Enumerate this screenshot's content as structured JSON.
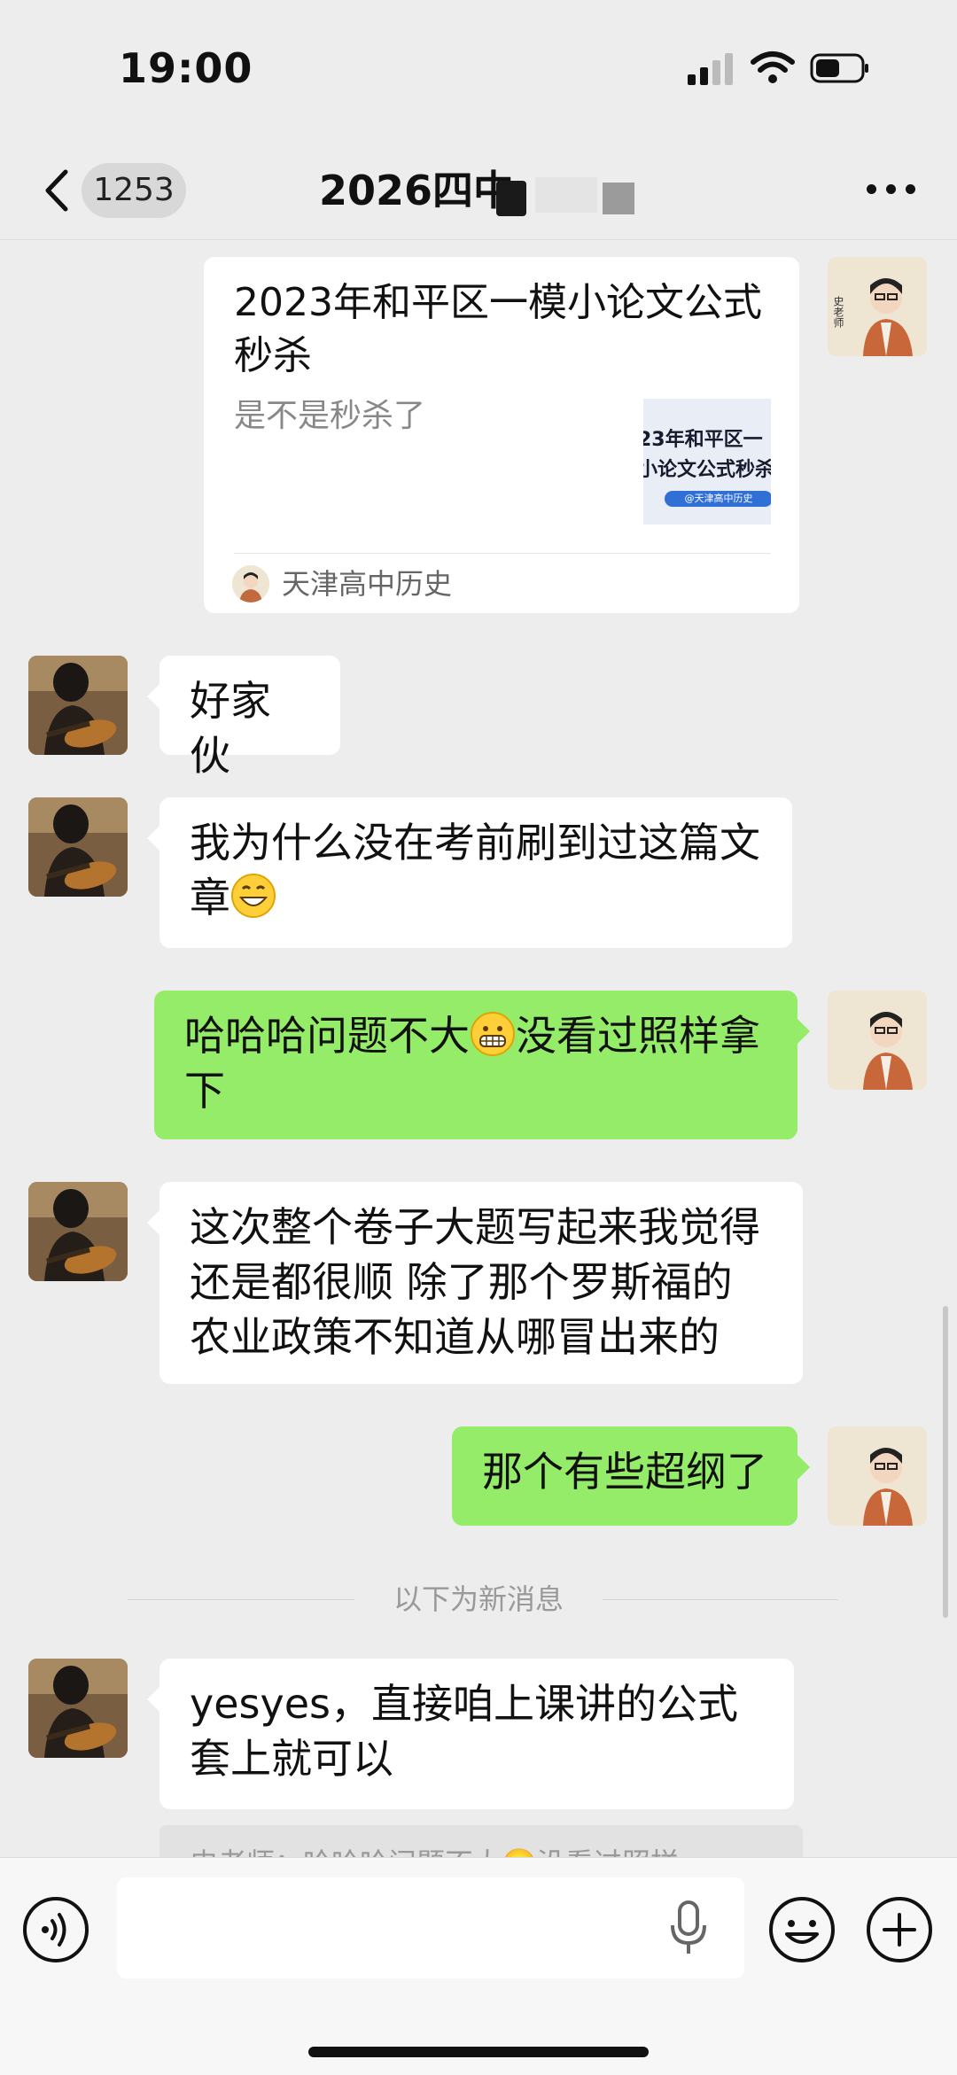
{
  "status_bar": {
    "time": "19:00"
  },
  "nav": {
    "unread_count": "1253",
    "title": "2026四中"
  },
  "article_card": {
    "title": "2023年和平区一模小论文公式秒杀",
    "description": "是不是秒杀了",
    "thumb_line1": "23年和平区一",
    "thumb_line2": "小论文公式秒杀",
    "thumb_tag": "@天津高中历史",
    "source": "天津高中历史",
    "avatar_text": "史老师"
  },
  "messages": [
    {
      "sender": "student",
      "text": "好家伙"
    },
    {
      "sender": "student",
      "text_before": "我为什么没在考前刷到过这篇文章",
      "emoji": "grinning-face"
    },
    {
      "sender": "me",
      "text_before": "哈哈哈问题不大",
      "emoji": "grimacing-face",
      "text_after": "没看过照样拿下"
    },
    {
      "sender": "student",
      "text": "这次整个卷子大题写起来我觉得还是都很顺 除了那个罗斯福的农业政策不知道从哪冒出来的"
    },
    {
      "sender": "me",
      "text": "那个有些超纲了"
    },
    {
      "sender": "student",
      "text": "yesyes，直接咱上课讲的公式套上就可以"
    }
  ],
  "new_messages_divider": "以下为新消息",
  "quote_preview": "史老师：哈哈哈问题不大😬没看过照样",
  "input_bar": {
    "text_value": ""
  },
  "colors": {
    "background": "#ededed",
    "my_bubble": "#95ec69",
    "their_bubble": "#ffffff"
  },
  "icons": [
    "back-arrow-icon",
    "more-icon",
    "voice-icon",
    "microphone-icon",
    "emoji-icon",
    "plus-icon",
    "signal-icon",
    "wifi-icon",
    "battery-icon"
  ]
}
